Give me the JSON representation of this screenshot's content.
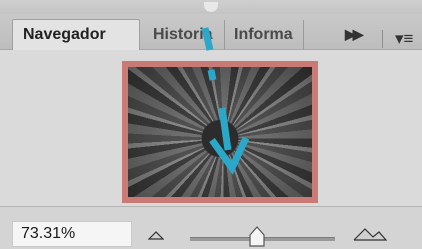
{
  "tabs": [
    {
      "label": "Navegador",
      "active": true
    },
    {
      "label": "Historia",
      "active": false
    },
    {
      "label": "Informa",
      "active": false
    }
  ],
  "tab_bar": {
    "more_icon": "double-chevron-right-icon",
    "menu_icon": "panel-menu-icon"
  },
  "zoom": {
    "value": "73.31%",
    "slider_fraction": 0.43
  },
  "colors": {
    "view_box": "#c97a74",
    "arrow": "#2aa7c9"
  }
}
